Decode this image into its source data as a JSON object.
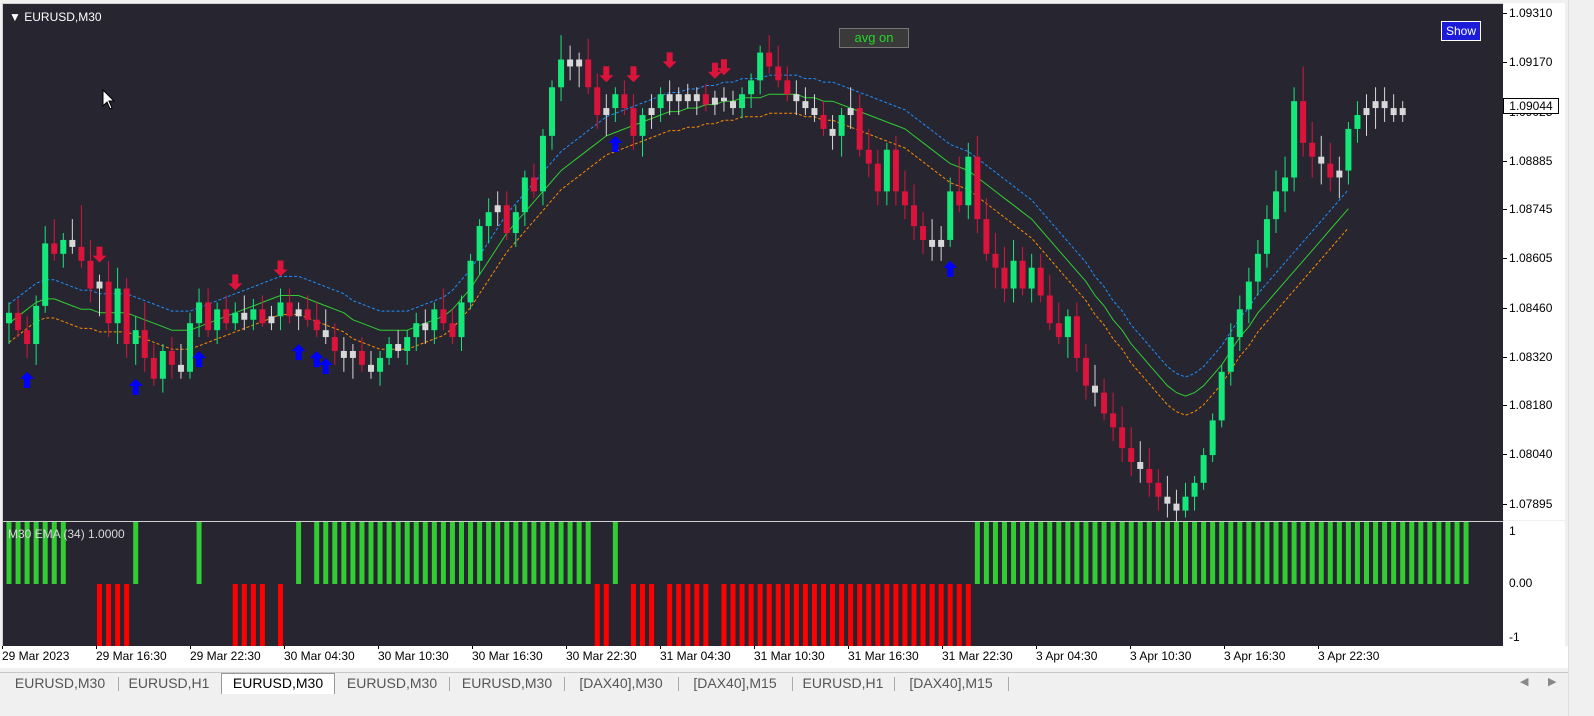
{
  "chart": {
    "symbol_title": "EURUSD,M30",
    "avg_button_label": "avg on",
    "show_button_label": "Show",
    "current_price": "1.09044",
    "price_axis_labels": [
      "1.09310",
      "1.09170",
      "1.09025",
      "1.08885",
      "1.08745",
      "1.08605",
      "1.08460",
      "1.08320",
      "1.08180",
      "1.08040",
      "1.07895"
    ],
    "time_axis_labels": [
      "29 Mar 2023",
      "29 Mar 16:30",
      "29 Mar 22:30",
      "30 Mar 04:30",
      "30 Mar 10:30",
      "30 Mar 16:30",
      "30 Mar 22:30",
      "31 Mar 04:30",
      "31 Mar 10:30",
      "31 Mar 16:30",
      "31 Mar 22:30",
      "3 Apr 04:30",
      "3 Apr 10:30",
      "3 Apr 16:30",
      "3 Apr 22:30"
    ],
    "colors": {
      "bull": "#14e87a",
      "bear": "#dc143c",
      "neutral": "#d8d8d8",
      "up_arrow": "#0000ff",
      "down_arrow": "#dc143c",
      "ma_mid": "#32cd32",
      "ma_upper": "#1e90ff",
      "ma_lower": "#ff8c00",
      "background": "#262530"
    }
  },
  "subwindow": {
    "title": "M30 EMA (34) 1.0000",
    "axis_labels": [
      "1",
      "0.00",
      "-1"
    ],
    "colors": {
      "positive": "#32cd32",
      "negative": "#ff0000"
    }
  },
  "tabs": [
    {
      "label": "EURUSD,M30",
      "active": false
    },
    {
      "label": "EURUSD,H1",
      "active": false
    },
    {
      "label": "EURUSD,M30",
      "active": true
    },
    {
      "label": "EURUSD,M30",
      "active": false
    },
    {
      "label": "EURUSD,M30",
      "active": false
    },
    {
      "label": "[DAX40],M30",
      "active": false
    },
    {
      "label": "[DAX40],M15",
      "active": false
    },
    {
      "label": "EURUSD,H1",
      "active": false
    },
    {
      "label": "[DAX40],M15",
      "active": false
    }
  ],
  "chart_data": {
    "type": "candlestick",
    "ylim": [
      1.0785,
      1.0934
    ],
    "candles": [
      [
        1.0842,
        1.0848,
        1.0836,
        1.0845
      ],
      [
        1.0845,
        1.0849,
        1.0838,
        1.084
      ],
      [
        1.084,
        1.0844,
        1.0832,
        1.0836
      ],
      [
        1.0836,
        1.085,
        1.083,
        1.0847
      ],
      [
        1.0847,
        1.087,
        1.0845,
        1.0865
      ],
      [
        1.0865,
        1.0872,
        1.086,
        1.0862
      ],
      [
        1.0862,
        1.0868,
        1.0858,
        1.0866
      ],
      [
        1.0866,
        1.0872,
        1.0862,
        1.0864
      ],
      [
        1.0864,
        1.0876,
        1.0858,
        1.086
      ],
      [
        1.086,
        1.0866,
        1.0848,
        1.0852
      ],
      [
        1.0852,
        1.0856,
        1.0844,
        1.0854
      ],
      [
        1.0854,
        1.086,
        1.0838,
        1.0842
      ],
      [
        1.0842,
        1.0858,
        1.0836,
        1.0852
      ],
      [
        1.0852,
        1.0855,
        1.0832,
        1.0836
      ],
      [
        1.0836,
        1.0844,
        1.083,
        1.084
      ],
      [
        1.084,
        1.0848,
        1.0828,
        1.0832
      ],
      [
        1.0832,
        1.0836,
        1.0824,
        1.0826
      ],
      [
        1.0826,
        1.0836,
        1.0822,
        1.0834
      ],
      [
        1.0834,
        1.0838,
        1.0826,
        1.083
      ],
      [
        1.083,
        1.0836,
        1.0826,
        1.0828
      ],
      [
        1.0828,
        1.0845,
        1.0826,
        1.0842
      ],
      [
        1.0842,
        1.0852,
        1.0838,
        1.0848
      ],
      [
        1.0848,
        1.0852,
        1.0838,
        1.084
      ],
      [
        1.084,
        1.0848,
        1.0836,
        1.0846
      ],
      [
        1.0846,
        1.085,
        1.084,
        1.0842
      ],
      [
        1.0842,
        1.0848,
        1.084,
        1.0845
      ],
      [
        1.0845,
        1.085,
        1.084,
        1.0843
      ],
      [
        1.0843,
        1.0849,
        1.084,
        1.0846
      ],
      [
        1.0846,
        1.085,
        1.0841,
        1.0842
      ],
      [
        1.0842,
        1.0847,
        1.084,
        1.0844
      ],
      [
        1.0844,
        1.0852,
        1.084,
        1.0848
      ],
      [
        1.0848,
        1.0852,
        1.0842,
        1.0844
      ],
      [
        1.0844,
        1.0848,
        1.084,
        1.0846
      ],
      [
        1.0846,
        1.085,
        1.0841,
        1.0843
      ],
      [
        1.0843,
        1.0848,
        1.0838,
        1.084
      ],
      [
        1.084,
        1.0846,
        1.0836,
        1.0838
      ],
      [
        1.0838,
        1.0842,
        1.083,
        1.0834
      ],
      [
        1.0834,
        1.0838,
        1.0828,
        1.0832
      ],
      [
        1.0832,
        1.0836,
        1.0826,
        1.0834
      ],
      [
        1.0834,
        1.0838,
        1.0828,
        1.083
      ],
      [
        1.083,
        1.0834,
        1.0826,
        1.0828
      ],
      [
        1.0828,
        1.0834,
        1.0824,
        1.0832
      ],
      [
        1.0832,
        1.0838,
        1.083,
        1.0836
      ],
      [
        1.0836,
        1.084,
        1.0832,
        1.0834
      ],
      [
        1.0834,
        1.084,
        1.083,
        1.0838
      ],
      [
        1.0838,
        1.0845,
        1.0834,
        1.0842
      ],
      [
        1.0842,
        1.0846,
        1.0836,
        1.084
      ],
      [
        1.084,
        1.0848,
        1.0836,
        1.0846
      ],
      [
        1.0846,
        1.0852,
        1.084,
        1.0842
      ],
      [
        1.0842,
        1.0846,
        1.0836,
        1.0838
      ],
      [
        1.0838,
        1.085,
        1.0834,
        1.0848
      ],
      [
        1.0848,
        1.0862,
        1.0846,
        1.086
      ],
      [
        1.086,
        1.0872,
        1.0856,
        1.087
      ],
      [
        1.087,
        1.0878,
        1.0865,
        1.0874
      ],
      [
        1.0874,
        1.088,
        1.087,
        1.0876
      ],
      [
        1.0876,
        1.088,
        1.0866,
        1.0868
      ],
      [
        1.0868,
        1.0876,
        1.0864,
        1.0874
      ],
      [
        1.0874,
        1.0886,
        1.087,
        1.0884
      ],
      [
        1.0884,
        1.0888,
        1.0878,
        1.088
      ],
      [
        1.088,
        1.0898,
        1.0876,
        1.0896
      ],
      [
        1.0896,
        1.0912,
        1.0892,
        1.091
      ],
      [
        1.091,
        1.0925,
        1.0906,
        1.0918
      ],
      [
        1.0918,
        1.0922,
        1.0912,
        1.0916
      ],
      [
        1.0916,
        1.092,
        1.091,
        1.0918
      ],
      [
        1.0918,
        1.0924,
        1.0908,
        1.091
      ],
      [
        1.091,
        1.0914,
        1.0898,
        1.0902
      ],
      [
        1.0902,
        1.0908,
        1.0896,
        1.0904
      ],
      [
        1.0904,
        1.091,
        1.09,
        1.0908
      ],
      [
        1.0908,
        1.0912,
        1.0902,
        1.0904
      ],
      [
        1.0904,
        1.0908,
        1.0892,
        1.0896
      ],
      [
        1.0896,
        1.0904,
        1.089,
        1.0902
      ],
      [
        1.0902,
        1.0908,
        1.0898,
        1.0904
      ],
      [
        1.0904,
        1.091,
        1.09,
        1.0908
      ],
      [
        1.0908,
        1.0912,
        1.0902,
        1.0906
      ],
      [
        1.0906,
        1.091,
        1.0902,
        1.0908
      ],
      [
        1.0908,
        1.0911,
        1.0904,
        1.0906
      ],
      [
        1.0906,
        1.091,
        1.0902,
        1.0908
      ],
      [
        1.0908,
        1.0911,
        1.0903,
        1.0905
      ],
      [
        1.0905,
        1.0909,
        1.0902,
        1.0907
      ],
      [
        1.0907,
        1.091,
        1.0903,
        1.0906
      ],
      [
        1.0906,
        1.0909,
        1.0902,
        1.0904
      ],
      [
        1.0904,
        1.091,
        1.0901,
        1.0908
      ],
      [
        1.0908,
        1.0914,
        1.0904,
        1.0912
      ],
      [
        1.0912,
        1.0922,
        1.0908,
        1.092
      ],
      [
        1.092,
        1.0925,
        1.0914,
        1.0916
      ],
      [
        1.0916,
        1.0922,
        1.091,
        1.0912
      ],
      [
        1.0912,
        1.0916,
        1.0906,
        1.0908
      ],
      [
        1.0908,
        1.0912,
        1.0902,
        1.0906
      ],
      [
        1.0906,
        1.091,
        1.0902,
        1.0904
      ],
      [
        1.0904,
        1.0908,
        1.09,
        1.0902
      ],
      [
        1.0902,
        1.0906,
        1.0896,
        1.0898
      ],
      [
        1.0898,
        1.0902,
        1.0892,
        1.0896
      ],
      [
        1.0896,
        1.0904,
        1.089,
        1.0902
      ],
      [
        1.0902,
        1.091,
        1.0898,
        1.0904
      ],
      [
        1.0904,
        1.0908,
        1.089,
        1.0892
      ],
      [
        1.0892,
        1.0898,
        1.0884,
        1.0888
      ],
      [
        1.0888,
        1.0892,
        1.0876,
        1.088
      ],
      [
        1.088,
        1.0894,
        1.0876,
        1.0892
      ],
      [
        1.0892,
        1.0896,
        1.0876,
        1.088
      ],
      [
        1.088,
        1.0886,
        1.0872,
        1.0876
      ],
      [
        1.0876,
        1.0882,
        1.0866,
        1.087
      ],
      [
        1.087,
        1.0874,
        1.0862,
        1.0866
      ],
      [
        1.0866,
        1.0872,
        1.086,
        1.0864
      ],
      [
        1.0864,
        1.087,
        1.086,
        1.0866
      ],
      [
        1.0866,
        1.0884,
        1.0864,
        1.088
      ],
      [
        1.088,
        1.089,
        1.0874,
        1.0876
      ],
      [
        1.0876,
        1.0894,
        1.0872,
        1.089
      ],
      [
        1.089,
        1.0896,
        1.0868,
        1.0872
      ],
      [
        1.0872,
        1.0878,
        1.086,
        1.0862
      ],
      [
        1.0862,
        1.0868,
        1.0852,
        1.0858
      ],
      [
        1.0858,
        1.0864,
        1.0848,
        1.0852
      ],
      [
        1.0852,
        1.0866,
        1.0848,
        1.086
      ],
      [
        1.086,
        1.0864,
        1.085,
        1.0852
      ],
      [
        1.0852,
        1.0862,
        1.0848,
        1.0858
      ],
      [
        1.0858,
        1.0862,
        1.0848,
        1.085
      ],
      [
        1.085,
        1.0856,
        1.084,
        1.0842
      ],
      [
        1.0842,
        1.0848,
        1.0836,
        1.0838
      ],
      [
        1.0838,
        1.0846,
        1.0832,
        1.0844
      ],
      [
        1.0844,
        1.0848,
        1.0828,
        1.0832
      ],
      [
        1.0832,
        1.0836,
        1.082,
        1.0824
      ],
      [
        1.0824,
        1.083,
        1.0818,
        1.0822
      ],
      [
        1.0822,
        1.0826,
        1.0814,
        1.0816
      ],
      [
        1.0816,
        1.0822,
        1.0808,
        1.0812
      ],
      [
        1.0812,
        1.0818,
        1.0802,
        1.0806
      ],
      [
        1.0806,
        1.0812,
        1.0798,
        1.0802
      ],
      [
        1.0802,
        1.0808,
        1.0796,
        1.08
      ],
      [
        1.08,
        1.0806,
        1.0792,
        1.0796
      ],
      [
        1.0796,
        1.08,
        1.0788,
        1.0792
      ],
      [
        1.0792,
        1.0798,
        1.0786,
        1.079
      ],
      [
        1.079,
        1.0794,
        1.0785,
        1.0788
      ],
      [
        1.0788,
        1.0796,
        1.0786,
        1.0792
      ],
      [
        1.0792,
        1.0798,
        1.0788,
        1.0796
      ],
      [
        1.0796,
        1.0806,
        1.0794,
        1.0804
      ],
      [
        1.0804,
        1.0816,
        1.0802,
        1.0814
      ],
      [
        1.0814,
        1.083,
        1.0812,
        1.0828
      ],
      [
        1.0828,
        1.0842,
        1.0824,
        1.0838
      ],
      [
        1.0838,
        1.085,
        1.0834,
        1.0846
      ],
      [
        1.0846,
        1.0858,
        1.0842,
        1.0854
      ],
      [
        1.0854,
        1.0866,
        1.085,
        1.0862
      ],
      [
        1.0862,
        1.0876,
        1.0858,
        1.0872
      ],
      [
        1.0872,
        1.0886,
        1.0868,
        1.088
      ],
      [
        1.088,
        1.089,
        1.0874,
        1.0884
      ],
      [
        1.0884,
        1.091,
        1.088,
        1.0906
      ],
      [
        1.0906,
        1.0916,
        1.089,
        1.0894
      ],
      [
        1.0894,
        1.09,
        1.0884,
        1.089
      ],
      [
        1.089,
        1.0896,
        1.0882,
        1.0888
      ],
      [
        1.0888,
        1.0894,
        1.088,
        1.0884
      ],
      [
        1.0884,
        1.089,
        1.0878,
        1.0886
      ],
      [
        1.0886,
        1.09,
        1.0882,
        1.0898
      ],
      [
        1.0898,
        1.0906,
        1.0894,
        1.0902
      ],
      [
        1.0902,
        1.0908,
        1.0896,
        1.0904
      ],
      [
        1.0904,
        1.091,
        1.0898,
        1.0906
      ],
      [
        1.0906,
        1.091,
        1.09,
        1.0904
      ],
      [
        1.0904,
        1.0908,
        1.09,
        1.0902
      ],
      [
        1.0902,
        1.0906,
        1.09,
        1.0904
      ]
    ],
    "ma_mid": [
      1.0842,
      1.0844,
      1.0846,
      1.0848,
      1.0849,
      1.0849,
      1.0848,
      1.0847,
      1.0846,
      1.0846,
      1.0845,
      1.0845,
      1.0845,
      1.0845,
      1.0844,
      1.0843,
      1.0842,
      1.0841,
      1.084,
      1.084,
      1.084,
      1.0841,
      1.0842,
      1.0843,
      1.0844,
      1.0845,
      1.0846,
      1.0847,
      1.0848,
      1.0849,
      1.085,
      1.085,
      1.085,
      1.0849,
      1.0848,
      1.0847,
      1.0846,
      1.0845,
      1.0843,
      1.0842,
      1.0841,
      1.084,
      1.084,
      1.084,
      1.084,
      1.0841,
      1.0842,
      1.0843,
      1.0844,
      1.0846,
      1.0849,
      1.0852,
      1.0856,
      1.086,
      1.0864,
      1.0868,
      1.0871,
      1.0874,
      1.0877,
      1.088,
      1.0883,
      1.0886,
      1.0888,
      1.089,
      1.0892,
      1.0894,
      1.0896,
      1.0897,
      1.0898,
      1.0899,
      1.09,
      1.0901,
      1.0902,
      1.0903,
      1.0903,
      1.0904,
      1.0904,
      1.0905,
      1.0905,
      1.0906,
      1.0906,
      1.0907,
      1.0907,
      1.0907,
      1.0908,
      1.0908,
      1.0908,
      1.0908,
      1.0907,
      1.0907,
      1.0906,
      1.0906,
      1.0905,
      1.0904,
      1.0903,
      1.0902,
      1.0901,
      1.09,
      1.0899,
      1.0898,
      1.0896,
      1.0894,
      1.0892,
      1.089,
      1.0888,
      1.0887,
      1.0886,
      1.0884,
      1.0882,
      1.088,
      1.0878,
      1.0876,
      1.0874,
      1.0872,
      1.0869,
      1.0866,
      1.0863,
      1.086,
      1.0857,
      1.0854,
      1.085,
      1.0847,
      1.0843,
      1.084,
      1.0836,
      1.0833,
      1.083,
      1.0827,
      1.0824,
      1.0822,
      1.0821,
      1.0822,
      1.0824,
      1.0827,
      1.083,
      1.0834,
      1.0838,
      1.0841,
      1.0845,
      1.0848,
      1.0851,
      1.0854,
      1.0857,
      1.086,
      1.0863,
      1.0866,
      1.0869,
      1.0872,
      1.0875
    ],
    "band_offset": 0.00055,
    "signals": {
      "up": [
        2,
        14,
        21,
        32,
        34,
        35,
        67,
        104
      ],
      "down": [
        10,
        25,
        30,
        66,
        69,
        73,
        78,
        79
      ]
    },
    "sub_series": [
      1,
      1,
      1,
      1,
      1,
      1,
      1,
      0,
      0,
      0,
      -1,
      -1,
      -1,
      -1,
      1,
      0,
      0,
      0,
      0,
      0,
      0,
      1,
      0,
      0,
      0,
      -1,
      -1,
      -1,
      -1,
      0,
      -1,
      0,
      1,
      0,
      1,
      1,
      1,
      1,
      1,
      1,
      1,
      1,
      1,
      1,
      1,
      1,
      1,
      1,
      1,
      1,
      1,
      1,
      1,
      1,
      1,
      1,
      1,
      1,
      1,
      1,
      1,
      1,
      1,
      1,
      1,
      -1,
      -1,
      1,
      0,
      -1,
      -1,
      -1,
      0,
      -1,
      -1,
      -1,
      -1,
      -1,
      0,
      -1,
      -1,
      -1,
      -1,
      -1,
      -1,
      -1,
      -1,
      -1,
      -1,
      -1,
      -1,
      -1,
      -1,
      -1,
      -1,
      -1,
      -1,
      -1,
      -1,
      -1,
      -1,
      -1,
      -1,
      -1,
      -1,
      -1,
      -1,
      1,
      1,
      1,
      1,
      1,
      1,
      1,
      1,
      1,
      1,
      1,
      1,
      1,
      1,
      1,
      1,
      1,
      1,
      1,
      1,
      1,
      1,
      1,
      1,
      1,
      1,
      1,
      1,
      1,
      1,
      1,
      1,
      1,
      1,
      1,
      1,
      1,
      1,
      1,
      1,
      1,
      1,
      1,
      1,
      1,
      1,
      1,
      1,
      1,
      1,
      1,
      1,
      1,
      1,
      1
    ]
  }
}
